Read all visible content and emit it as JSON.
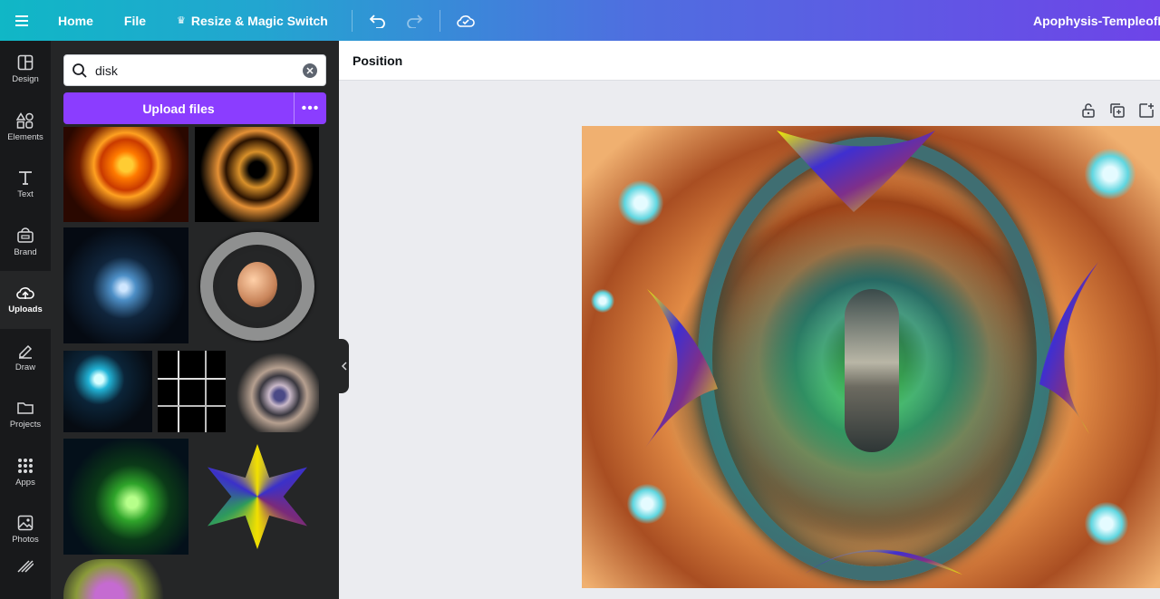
{
  "topbar": {
    "home_label": "Home",
    "file_label": "File",
    "resize_label": "Resize & Magic Switch",
    "doc_title": "Apophysis-TempleofRo"
  },
  "rail": {
    "items": [
      {
        "label": "Design",
        "icon": "layout-icon"
      },
      {
        "label": "Elements",
        "icon": "shapes-icon"
      },
      {
        "label": "Text",
        "icon": "text-icon"
      },
      {
        "label": "Brand",
        "icon": "brand-icon"
      },
      {
        "label": "Uploads",
        "icon": "cloud-upload-icon"
      },
      {
        "label": "Draw",
        "icon": "pen-icon"
      },
      {
        "label": "Projects",
        "icon": "folder-icon"
      },
      {
        "label": "Apps",
        "icon": "apps-grid-icon"
      },
      {
        "label": "Photos",
        "icon": "image-icon"
      }
    ],
    "active": "Uploads"
  },
  "panel": {
    "search_value": "disk",
    "upload_label": "Upload files",
    "more_label": "•••"
  },
  "editor": {
    "context_label": "Position"
  },
  "colors": {
    "accent_purple": "#8b3dff",
    "rail_bg": "#18191b",
    "panel_bg": "#252627"
  }
}
